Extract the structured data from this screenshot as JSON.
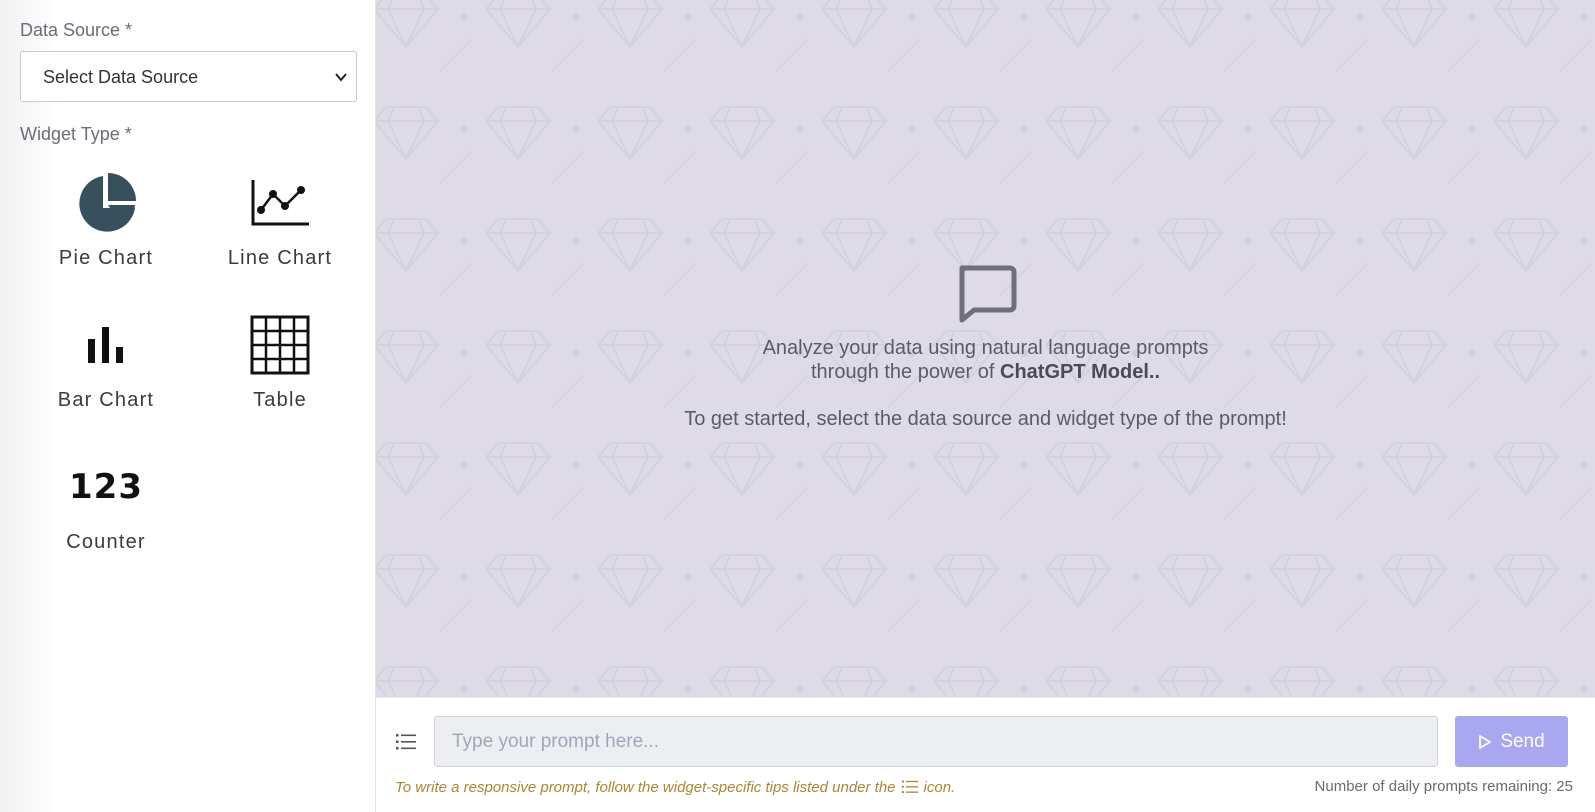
{
  "sidebar": {
    "data_source_label": "Data Source *",
    "data_source_selected": "Select Data Source",
    "widget_type_label": "Widget Type *",
    "widgets": [
      {
        "label": "Pie Chart",
        "icon": "pie-chart-icon"
      },
      {
        "label": "Line Chart",
        "icon": "line-chart-icon"
      },
      {
        "label": "Bar Chart",
        "icon": "bar-chart-icon"
      },
      {
        "label": "Table",
        "icon": "table-icon"
      },
      {
        "label": "Counter",
        "icon": "counter-icon",
        "glyph": "123"
      }
    ]
  },
  "main": {
    "intro_line1": "Analyze your data using natural language prompts",
    "intro_line2_prefix": "through the power of ",
    "intro_line2_bold": "ChatGPT Model..",
    "intro_line3": "To get started, select the data source and widget type of the prompt!",
    "icon": "chat-bubble-icon",
    "background_color": "#dedbe6"
  },
  "composer": {
    "placeholder": "Type your prompt here...",
    "send_label": "Send",
    "tip_prefix": "To write a responsive prompt, follow the widget-specific tips listed under the",
    "tip_suffix": "icon.",
    "remaining_text": "Number of daily prompts remaining: 25",
    "send_color": "#a8a8f0",
    "tip_color": "#b0852e"
  }
}
